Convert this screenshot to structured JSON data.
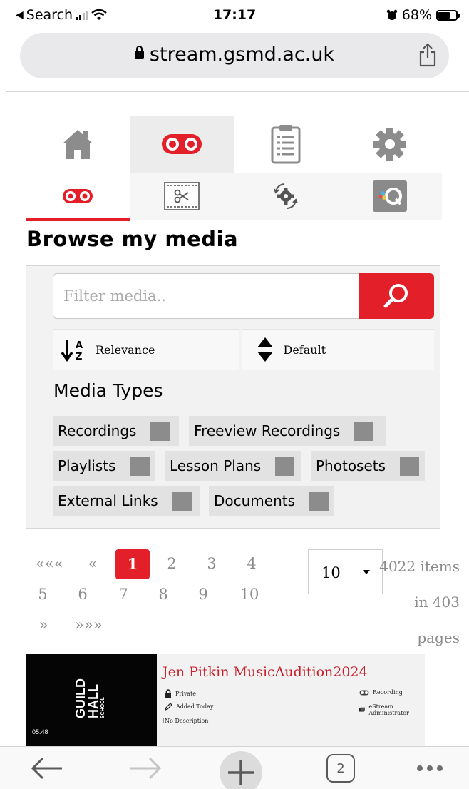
{
  "status": {
    "back_app": "Search",
    "time": "17:17",
    "battery": "68%",
    "battery_level": 0.68
  },
  "browser": {
    "url": "stream.gsmd.ac.uk",
    "open_tabs": "2"
  },
  "nav": {
    "main_tabs": [
      {
        "icon": "home-icon",
        "active": false
      },
      {
        "icon": "recordings-icon",
        "active": true
      },
      {
        "icon": "clipboard-icon",
        "active": false
      },
      {
        "icon": "gear-icon",
        "active": false
      }
    ],
    "sub_tabs": [
      {
        "icon": "recordings-icon",
        "active": true
      },
      {
        "icon": "edit-clip-icon",
        "active": false
      },
      {
        "icon": "process-icon",
        "active": false
      },
      {
        "icon": "quiz-icon",
        "active": false
      }
    ]
  },
  "page": {
    "title": "Browse my media"
  },
  "filter": {
    "placeholder": "Filter media..",
    "sort_field": "Relevance",
    "sort_order": "Default",
    "media_types_label": "Media Types",
    "media_types": [
      "Recordings",
      "Freeview Recordings",
      "Playlists",
      "Lesson Plans",
      "Photosets",
      "External Links",
      "Documents"
    ]
  },
  "pagination": {
    "first": "«««",
    "prev": "«",
    "pages": [
      "1",
      "2",
      "3",
      "4",
      "5",
      "6",
      "7",
      "8",
      "9",
      "10"
    ],
    "current": "1",
    "next": "»",
    "last": "»»»",
    "per_page": "10",
    "items_text_1": "4022 items",
    "items_text_2": "in 403",
    "items_text_3": "pages"
  },
  "media_items": [
    {
      "title": "Jen Pitkin MusicAudition2024",
      "duration": "05:48",
      "thumb_line1": "GUILD",
      "thumb_line2": "HALL",
      "thumb_line3": "SCHOOL",
      "privacy": "Private",
      "added": "Added Today",
      "description": "[No Description]",
      "type": "Recording",
      "owner": "eStream Administrator"
    }
  ],
  "colors": {
    "accent": "#e32029",
    "panel_bg": "#f2f2f2",
    "icon_grey": "#8c8c8c"
  }
}
